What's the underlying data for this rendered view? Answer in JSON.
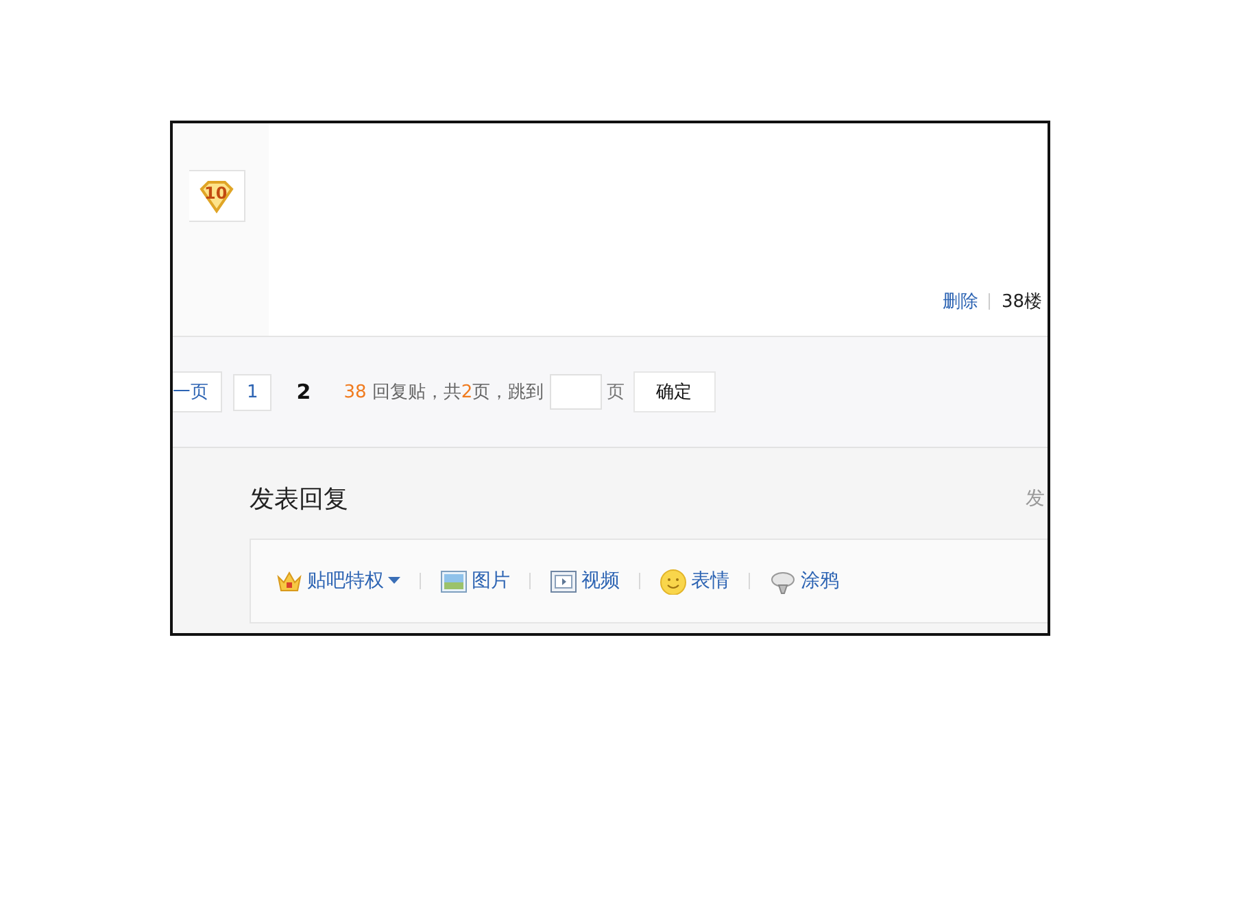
{
  "post": {
    "badge": "10",
    "actions": [
      {
        "label": "删除",
        "kind": "link"
      }
    ],
    "floor": "38楼"
  },
  "pagination": {
    "pages": [
      {
        "label": "一页",
        "kind": "prev",
        "selected": false
      },
      {
        "label": "1",
        "kind": "page",
        "selected": false
      },
      {
        "label": "2",
        "kind": "page",
        "selected": true
      }
    ],
    "reply_count": "38",
    "reply_label": "回复贴，共",
    "page_total": "2",
    "jump_label": "页，跳到",
    "page_unit": "页",
    "confirm": "确定"
  },
  "reply": {
    "title": "发表回复",
    "side_text": "发",
    "toolbar": [
      {
        "label": "贴吧特权",
        "kind": "crown",
        "dropdown": true
      },
      {
        "label": "图片",
        "kind": "image",
        "dropdown": false
      },
      {
        "label": "视频",
        "kind": "video",
        "dropdown": false
      },
      {
        "label": "表情",
        "kind": "smile",
        "dropdown": false
      },
      {
        "label": "涂鸦",
        "kind": "graffiti",
        "dropdown": false
      }
    ]
  }
}
